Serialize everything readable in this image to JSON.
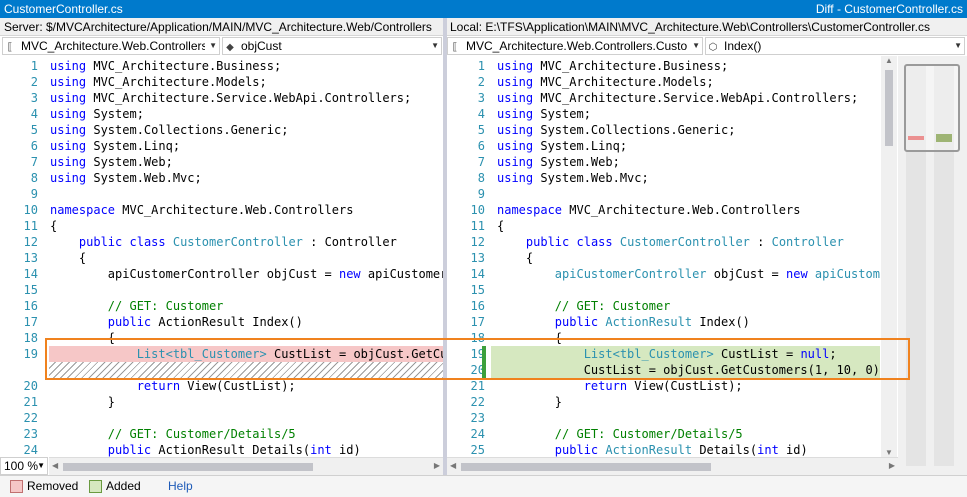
{
  "window": {
    "left_title": "CustomerController.cs",
    "right_title": "Diff - CustomerController.cs"
  },
  "paths": {
    "left": "Server: $/MVCArchitecture/Application/MAIN/MVC_Architecture.Web/Controllers",
    "right": "Local: E:\\TFS\\Application\\MAIN\\MVC_Architecture.Web\\Controllers\\CustomerController.cs"
  },
  "combos": {
    "left_type": "MVC_Architecture.Web.Controllers",
    "left_member": "objCust",
    "right_type": "MVC_Architecture.Web.Controllers.Custor",
    "right_member": "Index()"
  },
  "left_lines": [
    {
      "n": "1",
      "t": [
        [
          "k",
          "using"
        ],
        [
          "p",
          " MVC_Architecture.Business;"
        ]
      ]
    },
    {
      "n": "2",
      "t": [
        [
          "k",
          "using"
        ],
        [
          "p",
          " MVC_Architecture.Models;"
        ]
      ]
    },
    {
      "n": "3",
      "t": [
        [
          "k",
          "using"
        ],
        [
          "p",
          " MVC_Architecture.Service.WebApi.Controllers;"
        ]
      ]
    },
    {
      "n": "4",
      "t": [
        [
          "k",
          "using"
        ],
        [
          "p",
          " System;"
        ]
      ]
    },
    {
      "n": "5",
      "t": [
        [
          "k",
          "using"
        ],
        [
          "p",
          " System.Collections.Generic;"
        ]
      ]
    },
    {
      "n": "6",
      "t": [
        [
          "k",
          "using"
        ],
        [
          "p",
          " System.Linq;"
        ]
      ]
    },
    {
      "n": "7",
      "t": [
        [
          "k",
          "using"
        ],
        [
          "p",
          " System.Web;"
        ]
      ]
    },
    {
      "n": "8",
      "t": [
        [
          "k",
          "using"
        ],
        [
          "p",
          " System.Web.Mvc;"
        ]
      ]
    },
    {
      "n": "9",
      "t": []
    },
    {
      "n": "10",
      "t": [
        [
          "k",
          "namespace"
        ],
        [
          "p",
          " MVC_Architecture.Web.Controllers"
        ]
      ]
    },
    {
      "n": "11",
      "t": [
        [
          "p",
          "{"
        ]
      ]
    },
    {
      "n": "12",
      "t": [
        [
          "p",
          "    "
        ],
        [
          "k",
          "public"
        ],
        [
          "p",
          " "
        ],
        [
          "k",
          "class"
        ],
        [
          "p",
          " "
        ],
        [
          "c",
          "CustomerController"
        ],
        [
          "p",
          " : Controller"
        ]
      ]
    },
    {
      "n": "13",
      "t": [
        [
          "p",
          "    {"
        ]
      ]
    },
    {
      "n": "14",
      "t": [
        [
          "p",
          "        apiCustomerController objCust = "
        ],
        [
          "k",
          "new"
        ],
        [
          "p",
          " apiCustomerC"
        ]
      ]
    },
    {
      "n": "15",
      "t": []
    },
    {
      "n": "16",
      "t": [
        [
          "p",
          "        "
        ],
        [
          "g",
          "// GET: Customer"
        ]
      ]
    },
    {
      "n": "17",
      "t": [
        [
          "p",
          "        "
        ],
        [
          "k",
          "public"
        ],
        [
          "p",
          " ActionResult Index()"
        ]
      ]
    },
    {
      "n": "18",
      "t": [
        [
          "p",
          "        {"
        ]
      ]
    },
    {
      "n": "19",
      "t": [
        [
          "p",
          "            "
        ],
        [
          "c",
          "List<tbl_Customer>"
        ],
        [
          "p",
          " CustList = objCust.GetCus"
        ]
      ]
    },
    {
      "n": "",
      "t": []
    },
    {
      "n": "20",
      "t": [
        [
          "p",
          "            "
        ],
        [
          "k",
          "return"
        ],
        [
          "p",
          " View(CustList);"
        ]
      ]
    },
    {
      "n": "21",
      "t": [
        [
          "p",
          "        }"
        ]
      ]
    },
    {
      "n": "22",
      "t": []
    },
    {
      "n": "23",
      "t": [
        [
          "p",
          "        "
        ],
        [
          "g",
          "// GET: Customer/Details/5"
        ]
      ]
    },
    {
      "n": "24",
      "t": [
        [
          "p",
          "        "
        ],
        [
          "k",
          "public"
        ],
        [
          "p",
          " ActionResult Details("
        ],
        [
          "k",
          "int"
        ],
        [
          "p",
          " id)"
        ]
      ]
    }
  ],
  "right_lines": [
    {
      "n": "1",
      "t": [
        [
          "k",
          "using"
        ],
        [
          "p",
          " MVC_Architecture.Business;"
        ]
      ]
    },
    {
      "n": "2",
      "t": [
        [
          "k",
          "using"
        ],
        [
          "p",
          " MVC_Architecture.Models;"
        ]
      ]
    },
    {
      "n": "3",
      "t": [
        [
          "k",
          "using"
        ],
        [
          "p",
          " MVC_Architecture.Service.WebApi.Controllers;"
        ]
      ]
    },
    {
      "n": "4",
      "t": [
        [
          "k",
          "using"
        ],
        [
          "p",
          " System;"
        ]
      ]
    },
    {
      "n": "5",
      "t": [
        [
          "k",
          "using"
        ],
        [
          "p",
          " System.Collections.Generic;"
        ]
      ]
    },
    {
      "n": "6",
      "t": [
        [
          "k",
          "using"
        ],
        [
          "p",
          " System.Linq;"
        ]
      ]
    },
    {
      "n": "7",
      "t": [
        [
          "k",
          "using"
        ],
        [
          "p",
          " System.Web;"
        ]
      ]
    },
    {
      "n": "8",
      "t": [
        [
          "k",
          "using"
        ],
        [
          "p",
          " System.Web.Mvc;"
        ]
      ]
    },
    {
      "n": "9",
      "t": []
    },
    {
      "n": "10",
      "t": [
        [
          "k",
          "namespace"
        ],
        [
          "p",
          " MVC_Architecture.Web.Controllers"
        ]
      ]
    },
    {
      "n": "11",
      "t": [
        [
          "p",
          "{"
        ]
      ]
    },
    {
      "n": "12",
      "t": [
        [
          "p",
          "    "
        ],
        [
          "k",
          "public"
        ],
        [
          "p",
          " "
        ],
        [
          "k",
          "class"
        ],
        [
          "p",
          " "
        ],
        [
          "c",
          "CustomerController"
        ],
        [
          "p",
          " : "
        ],
        [
          "c",
          "Controller"
        ]
      ]
    },
    {
      "n": "13",
      "t": [
        [
          "p",
          "    {"
        ]
      ]
    },
    {
      "n": "14",
      "t": [
        [
          "p",
          "        "
        ],
        [
          "c",
          "apiCustomerController"
        ],
        [
          "p",
          " objCust = "
        ],
        [
          "k",
          "new"
        ],
        [
          "p",
          " "
        ],
        [
          "c",
          "apiCustomerC"
        ]
      ]
    },
    {
      "n": "15",
      "t": []
    },
    {
      "n": "16",
      "t": [
        [
          "p",
          "        "
        ],
        [
          "g",
          "// GET: Customer"
        ]
      ]
    },
    {
      "n": "17",
      "t": [
        [
          "p",
          "        "
        ],
        [
          "k",
          "public"
        ],
        [
          "p",
          " "
        ],
        [
          "c",
          "ActionResult"
        ],
        [
          "p",
          " Index()"
        ]
      ]
    },
    {
      "n": "18",
      "t": [
        [
          "p",
          "        {"
        ]
      ]
    },
    {
      "n": "19",
      "t": [
        [
          "p",
          "            "
        ],
        [
          "c",
          "List<tbl_Customer>"
        ],
        [
          "p",
          " CustList = "
        ],
        [
          "k",
          "null"
        ],
        [
          "p",
          ";"
        ]
      ]
    },
    {
      "n": "20",
      "t": [
        [
          "p",
          "            CustList = objCust.GetCustomers(1, 10, 0).To"
        ]
      ]
    },
    {
      "n": "21",
      "t": [
        [
          "p",
          "            "
        ],
        [
          "k",
          "return"
        ],
        [
          "p",
          " View(CustList);"
        ]
      ]
    },
    {
      "n": "22",
      "t": [
        [
          "p",
          "        }"
        ]
      ]
    },
    {
      "n": "23",
      "t": []
    },
    {
      "n": "24",
      "t": [
        [
          "p",
          "        "
        ],
        [
          "g",
          "// GET: Customer/Details/5"
        ]
      ]
    },
    {
      "n": "25",
      "t": [
        [
          "p",
          "        "
        ],
        [
          "k",
          "public"
        ],
        [
          "p",
          " "
        ],
        [
          "c",
          "ActionResult"
        ],
        [
          "p",
          " Details("
        ],
        [
          "k",
          "int"
        ],
        [
          "p",
          " id)"
        ]
      ]
    }
  ],
  "zoom": "100 %",
  "legend": {
    "removed": "Removed",
    "added": "Added",
    "help": "Help"
  },
  "colors": {
    "removed": "#f6c7c7",
    "added": "#d6e8c0",
    "accent": "#007acc",
    "focus": "#f0821e"
  }
}
